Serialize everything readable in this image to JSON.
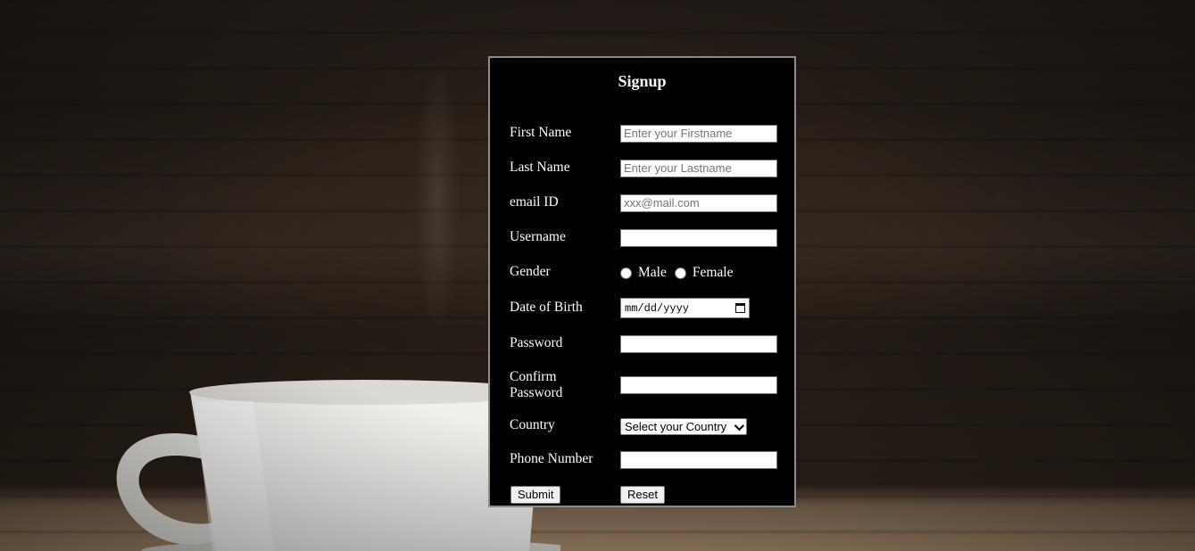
{
  "form": {
    "title": "Signup",
    "first_name": {
      "label": "First Name",
      "placeholder": "Enter your Firstname"
    },
    "last_name": {
      "label": "Last Name",
      "placeholder": "Enter your Lastname"
    },
    "email": {
      "label": "email ID",
      "placeholder": "xxx@mail.com"
    },
    "username": {
      "label": "Username",
      "value": ""
    },
    "gender": {
      "label": "Gender",
      "options": [
        "Male",
        "Female"
      ]
    },
    "dob": {
      "label": "Date of Birth",
      "placeholder": "mm/dd/yyyy"
    },
    "password": {
      "label": "Password",
      "value": ""
    },
    "confirm_password": {
      "label_line1": "Confirm",
      "label_line2": "Password",
      "value": ""
    },
    "country": {
      "label": "Country",
      "selected": "Select your Country"
    },
    "phone": {
      "label": "Phone Number",
      "value": ""
    },
    "submit_label": "Submit",
    "reset_label": "Reset"
  },
  "colors": {
    "panel_bg": "#000000",
    "panel_border": "#8c8c8c",
    "text": "#ffffff",
    "placeholder": "#757575"
  }
}
